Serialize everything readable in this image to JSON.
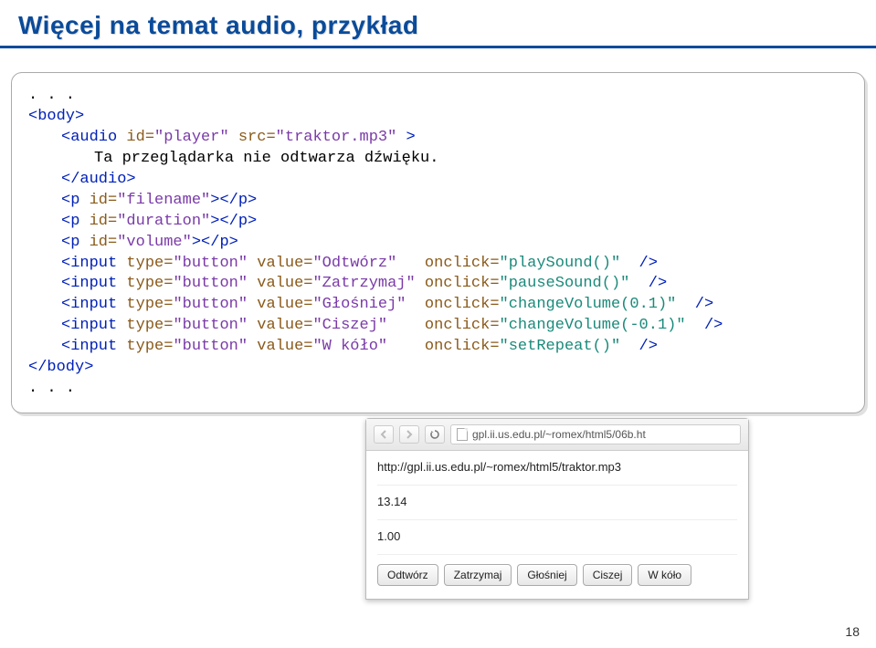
{
  "page": {
    "number": "18"
  },
  "title": "Więcej na temat audio, przykład",
  "code": {
    "l01": ". . .",
    "l02a": "<body>",
    "l03a": "<audio",
    "l03b": " id=",
    "l03c": "\"player\"",
    "l03d": " src=",
    "l03e": "\"traktor.mp3\"",
    "l03f": " >",
    "l04": "Ta przeglądarka nie odtwarza dźwięku.",
    "l05": "</audio>",
    "l06a": "<p",
    "l06b": " id=",
    "l06c": "\"filename\"",
    "l06d": "></p>",
    "l07a": "<p",
    "l07b": " id=",
    "l07c": "\"duration\"",
    "l07d": "></p>",
    "l08a": "<p",
    "l08b": " id=",
    "l08c": "\"volume\"",
    "l08d": "></p>",
    "l09a": "<input",
    "l09b": " type=",
    "l09c": "\"button\"",
    "l09d": " value=",
    "l09e": "\"Odtwórz\"",
    "l09f": "   onclick=",
    "l09g": "\"playSound()\"",
    "l09h": "  />",
    "l10a": "<input",
    "l10b": " type=",
    "l10c": "\"button\"",
    "l10d": " value=",
    "l10e": "\"Zatrzymaj\"",
    "l10f": " onclick=",
    "l10g": "\"pauseSound()\"",
    "l10h": "  />",
    "l11a": "<input",
    "l11b": " type=",
    "l11c": "\"button\"",
    "l11d": " value=",
    "l11e": "\"Głośniej\"",
    "l11f": "  onclick=",
    "l11g": "\"changeVolume(0.1)\"",
    "l11h": "  />",
    "l12a": "<input",
    "l12b": " type=",
    "l12c": "\"button\"",
    "l12d": " value=",
    "l12e": "\"Ciszej\"",
    "l12f": "    onclick=",
    "l12g": "\"changeVolume(-0.1)\"",
    "l12h": "  />",
    "l13a": "<input",
    "l13b": " type=",
    "l13c": "\"button\"",
    "l13d": " value=",
    "l13e": "\"W kóło\"",
    "l13f": "    onclick=",
    "l13g": "\"setRepeat()\"",
    "l13h": "  />",
    "l14": "</body>",
    "l15": ". . ."
  },
  "browser": {
    "url_display": "gpl.ii.us.edu.pl/~romex/html5/06b.ht",
    "filename": "http://gpl.ii.us.edu.pl/~romex/html5/traktor.mp3",
    "duration": "13.14",
    "volume": "1.00",
    "buttons": {
      "play": "Odtwórz",
      "pause": "Zatrzymaj",
      "louder": "Głośniej",
      "quieter": "Ciszej",
      "repeat": "W kóło"
    }
  }
}
